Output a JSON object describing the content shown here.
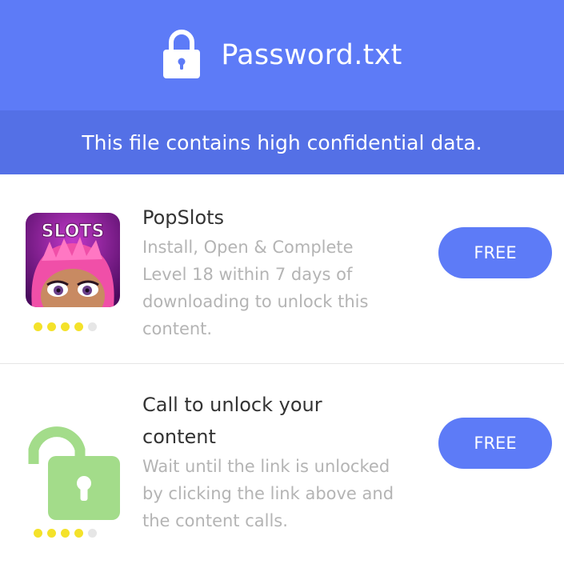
{
  "header": {
    "title": "Password.txt",
    "icon": "lock-icon",
    "background": "#5d7bf7"
  },
  "subheader": {
    "text": "This file contains high confidential data.",
    "background": "#5470e6"
  },
  "offers": [
    {
      "title": "PopSlots",
      "description": "Install, Open & Complete Level 18 within 7 days of downloading to unlock this content.",
      "icon": "popslots-app-icon",
      "icon_text": "SLOTS",
      "rating": 4,
      "rating_max": 5,
      "button_label": "FREE"
    },
    {
      "title": "Call to unlock your content",
      "description": "Wait until the link is unlocked by clicking the link above and the content calls.",
      "icon": "unlocked-padlock-icon",
      "rating": 4,
      "rating_max": 5,
      "button_label": "FREE"
    }
  ],
  "colors": {
    "accent": "#5d7bf7",
    "rating_on": "#f4e22a",
    "rating_off": "#e6e6e6",
    "unlock_green": "#a3dc8a"
  }
}
